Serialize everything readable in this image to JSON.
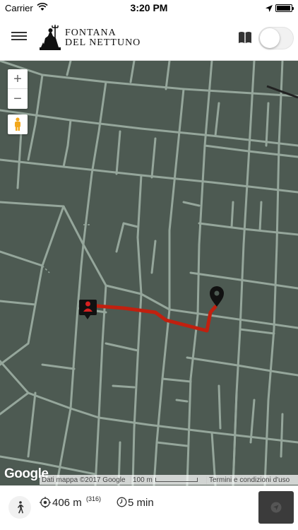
{
  "status_bar": {
    "carrier": "Carrier",
    "time": "3:20 PM"
  },
  "header": {
    "title_line1": "FONTANA",
    "title_line2": "DEL NETTUNO",
    "menu_icon": "hamburger-icon",
    "book_icon": "open-book-icon",
    "toggle_state": "off"
  },
  "map": {
    "zoom_in": "+",
    "zoom_out": "−",
    "provider_logo": "Google",
    "attribution": "Dati mappa ©2017 Google",
    "scale_label": "100 m",
    "terms": "Termini e condizioni d'uso",
    "route_color": "#c1200f",
    "background_color": "#4d5a52",
    "street_color": "#95a69b"
  },
  "route_info": {
    "distance": "406 m",
    "steps": "(316)",
    "duration": "5 min"
  },
  "colors": {
    "nav_button": "#3b3b3b"
  }
}
